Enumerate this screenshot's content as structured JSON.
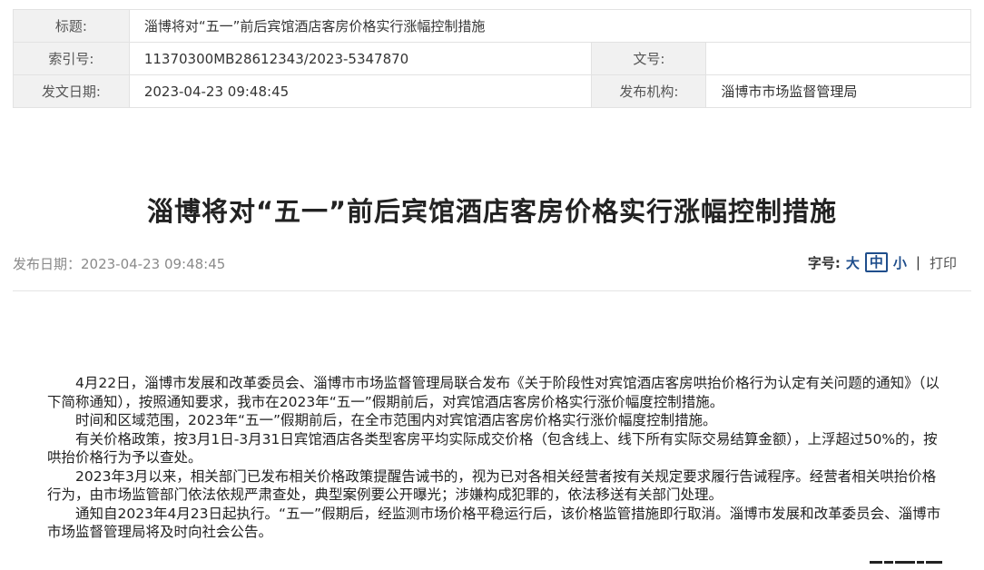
{
  "meta": {
    "title_label": "标题:",
    "title_value": "淄博将对“五一”前后宾馆酒店客房价格实行涨幅控制措施",
    "index_label": "索引号:",
    "index_value": "11370300MB28612343/2023-5347870",
    "docno_label": "文号:",
    "docno_value": "",
    "date_label": "发文日期:",
    "date_value": "2023-04-23 09:48:45",
    "org_label": "发布机构:",
    "org_value": "淄博市市场监督管理局"
  },
  "article": {
    "title": "淄博将对“五一”前后宾馆酒店客房价格实行涨幅控制措施",
    "pubdate": "发布日期：2023-04-23 09:48:45",
    "font_label": "字号:",
    "font_large": "大",
    "font_medium": "中",
    "font_small": "小",
    "separator": "|",
    "print": "打印",
    "paragraphs": [
      "4月22日，淄博市发展和改革委员会、淄博市市场监督管理局联合发布《关于阶段性对宾馆酒店客房哄抬价格行为认定有关问题的通知》（以下简称通知），按照通知要求，我市在2023年“五一”假期前后，对宾馆酒店客房价格实行涨价幅度控制措施。",
      "时间和区域范围，2023年“五一”假期前后，在全市范围内对宾馆酒店客房价格实行涨价幅度控制措施。",
      "有关价格政策，按3月1日-3月31日宾馆酒店各类型客房平均实际成交价格（包含线上、线下所有实际交易结算金额），上浮超过50%的，按哄抬价格行为予以查处。",
      "2023年3月以来，相关部门已发布相关价格政策提醒告诫书的，视为已对各相关经营者按有关规定要求履行告诫程序。经营者相关哄抬价格行为，由市场监管部门依法依规严肃查处，典型案例要公开曝光；涉嫌构成犯罪的，依法移送有关部门处理。",
      "通知自2023年4月23日起执行。“五一”假期后，经监测市场价格平稳运行后，该价格监管措施即行取消。淄博市发展和改革委员会、淄博市市场监督管理局将及时向社会公告。"
    ]
  }
}
